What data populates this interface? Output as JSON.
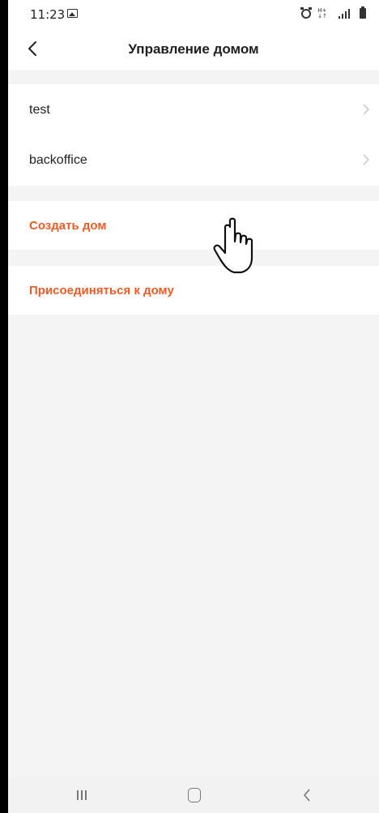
{
  "status_bar": {
    "time": "11:23",
    "gallery_icon": "image-icon",
    "alarm_icon": "alarm-clock-icon",
    "network_icon": "network-activity-icon",
    "signal_icon": "cell-signal-icon",
    "battery_icon": "battery-icon"
  },
  "header": {
    "title": "Управление домом",
    "back_icon": "chevron-left-icon"
  },
  "homes": [
    {
      "label": "test"
    },
    {
      "label": "backoffice"
    }
  ],
  "actions": {
    "create_home": "Создать дом",
    "join_home": "Присоединяться к дому"
  },
  "navigation_bar": {
    "recents_icon": "recents-icon",
    "home_icon": "home-icon",
    "back_icon": "back-icon"
  },
  "colors": {
    "accent": "#f05a24",
    "background": "#f4f4f4",
    "surface": "#ffffff"
  }
}
